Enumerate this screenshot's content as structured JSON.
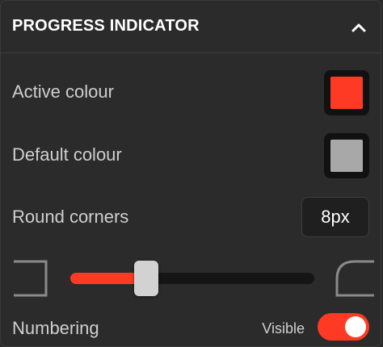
{
  "section": {
    "title": "PROGRESS INDICATOR",
    "collapse_icon": "chevron-up-icon"
  },
  "active_colour": {
    "label": "Active colour",
    "value": "#ff3a24"
  },
  "default_colour": {
    "label": "Default colour",
    "value": "#a8a8a8"
  },
  "round_corners": {
    "label": "Round corners",
    "value": "8px",
    "slider_fraction": 0.31,
    "min_icon": "square-corner-icon",
    "max_icon": "rounded-corner-icon"
  },
  "numbering": {
    "label": "Numbering",
    "state_label": "Visible",
    "enabled": true
  },
  "colors": {
    "accent": "#ff3a24",
    "panel_bg": "#2b2b2b"
  }
}
